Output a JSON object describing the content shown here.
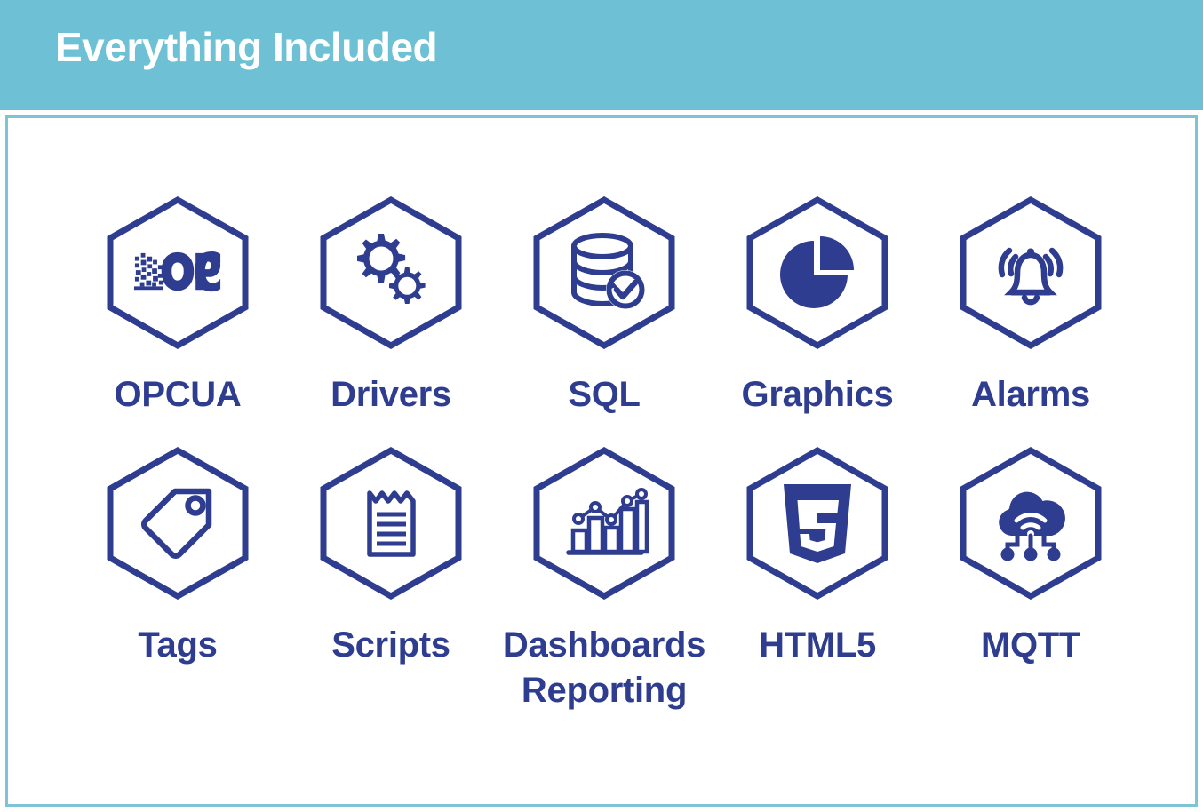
{
  "header": {
    "title": "Everything Included",
    "background_color": "#6ec1d4",
    "text_color": "#ffffff"
  },
  "panel": {
    "background_color": "#ffffff",
    "border_color": "#7ec4d6"
  },
  "theme": {
    "accent_color": "#6ec1d4",
    "icon_color": "#2e3d8f",
    "label_color": "#2e3d8f"
  },
  "features": {
    "rows": [
      [
        {
          "label": "OPCUA",
          "icon": "opc-foundation-logo-icon"
        },
        {
          "label": "Drivers",
          "icon": "gears-icon"
        },
        {
          "label": "SQL",
          "icon": "database-check-icon"
        },
        {
          "label": "Graphics",
          "icon": "pie-chart-icon"
        },
        {
          "label": "Alarms",
          "icon": "ringing-bell-icon"
        }
      ],
      [
        {
          "label": "Tags",
          "icon": "price-tag-icon"
        },
        {
          "label": "Scripts",
          "icon": "script-document-icon"
        },
        {
          "label": "Dashboards\nReporting",
          "icon": "bar-chart-trend-icon"
        },
        {
          "label": "HTML5",
          "icon": "html5-shield-icon"
        },
        {
          "label": "MQTT",
          "icon": "cloud-wifi-nodes-icon"
        }
      ]
    ]
  }
}
